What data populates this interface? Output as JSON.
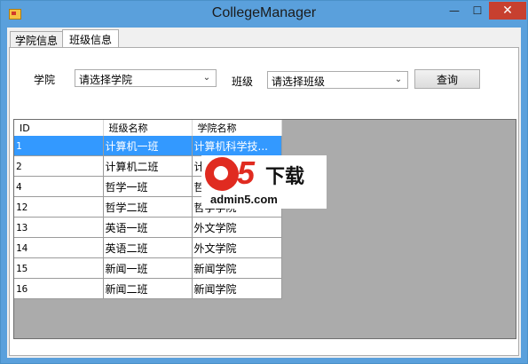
{
  "window": {
    "title": "CollegeManager",
    "min_symbol": "—",
    "max_symbol": "☐",
    "close_symbol": "✕"
  },
  "tabs": [
    {
      "label": "学院信息"
    },
    {
      "label": "班级信息"
    }
  ],
  "filters": {
    "college_label": "学院",
    "college_value": "请选择学院",
    "class_label": "班级",
    "class_value": "请选择班级",
    "query_button": "查询",
    "dropdown_arrow": "⌄"
  },
  "grid": {
    "headers": [
      "ID",
      "班级名称",
      "学院名称"
    ],
    "rows": [
      [
        "1",
        "计算机一班",
        "计算机科学技..."
      ],
      [
        "2",
        "计算机二班",
        "计"
      ],
      [
        "4",
        "哲学一班",
        "哲"
      ],
      [
        "12",
        "哲学二班",
        "哲学学院"
      ],
      [
        "13",
        "英语一班",
        "外文学院"
      ],
      [
        "14",
        "英语二班",
        "外文学院"
      ],
      [
        "15",
        "新闻一班",
        "新闻学院"
      ],
      [
        "16",
        "新闻二班",
        "新闻学院"
      ]
    ],
    "selected_row": 0
  },
  "watermark": {
    "brand": "5",
    "text": "下载",
    "url": "admin5.com"
  },
  "colors": {
    "titlebar": "#5aa0dc",
    "close_button": "#c7402f",
    "selection": "#3399ff",
    "grid_background": "#ababab"
  }
}
